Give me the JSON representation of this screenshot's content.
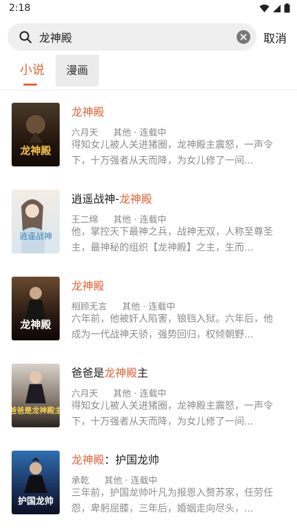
{
  "status_bar": {
    "time": "2:18",
    "icons": [
      "wifi-icon",
      "signal-icon",
      "battery-icon"
    ]
  },
  "search": {
    "value": "龙神殿",
    "placeholder": "",
    "cancel_label": "取消"
  },
  "tabs": [
    {
      "label": "小说",
      "active": true
    },
    {
      "label": "漫画",
      "active": false
    }
  ],
  "accent_color": "#e2653a",
  "results": [
    {
      "title_parts": [
        {
          "text": "龙神殿",
          "highlight": true
        }
      ],
      "author": "六月天",
      "category_status": "其他 · 连载中",
      "description": "得知女儿被人关进猪圈，龙神殿主震怒，一声令下，十万强者从天而降，为女儿修了一间...",
      "cover_text": "龙神殿"
    },
    {
      "title_parts": [
        {
          "text": "逍遥战神-",
          "highlight": false
        },
        {
          "text": "龙神殿",
          "highlight": true
        }
      ],
      "author": "王二绵",
      "category_status": "其他 · 连载中",
      "description": "他，掌控天下最神之兵，战神无双，人称至尊圣主，最神秘的组织【龙神殿】之主，生而...",
      "cover_text": "逍遥战神"
    },
    {
      "title_parts": [
        {
          "text": "龙神殿",
          "highlight": true
        }
      ],
      "author": "相顾无言",
      "category_status": "其他 · 连载中",
      "description": "六年前，他被奸人陷害，锒铛入狱。六年后，他成为一代战神天骄，强势回归，权倾朝野...",
      "cover_text": "龙神殿"
    },
    {
      "title_parts": [
        {
          "text": "爸爸是",
          "highlight": false
        },
        {
          "text": "龙神殿",
          "highlight": true
        },
        {
          "text": "主",
          "highlight": false
        }
      ],
      "author": "六月天",
      "category_status": "其他 · 连载中",
      "description": "得知女儿被人关进猪圈，龙神殿主震怒，一声令下，十万强者从天而降，为女儿修了一间...",
      "cover_text": "爸爸是龙神殿主"
    },
    {
      "title_parts": [
        {
          "text": "龙神殿",
          "highlight": true
        },
        {
          "text": "：护国龙帅",
          "highlight": false
        }
      ],
      "author": "承乾",
      "category_status": "其他 · 连载中",
      "description": "三年前，护国龙帅叶凡为报恩入赘苏家，任劳任怨，卑躬屈膝，三年后，婚姻走向尽头，...",
      "cover_text": "护国龙帅"
    }
  ]
}
